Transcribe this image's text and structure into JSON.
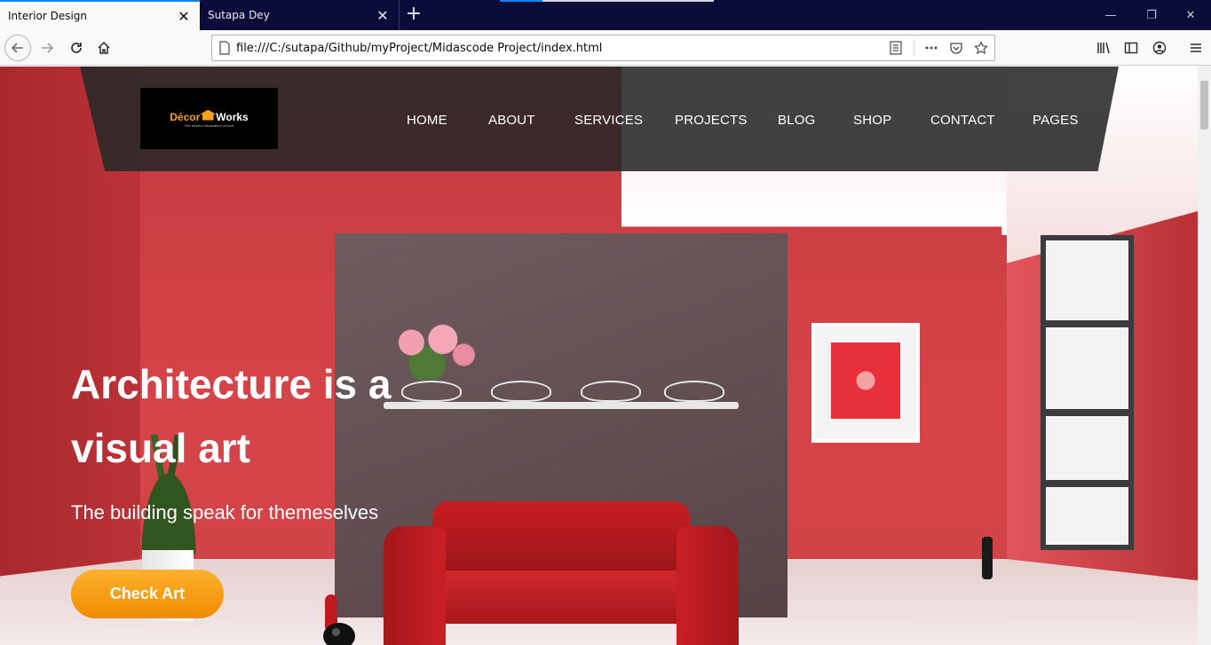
{
  "browser": {
    "tabs": [
      {
        "title": "Interior Design",
        "active": true
      },
      {
        "title": "Sutapa Dey",
        "active": false
      }
    ],
    "url": "file:///C:/sutapa/Github/myProject/Midascode Project/index.html"
  },
  "site": {
    "logo": {
      "part1": "Décor",
      "part2": "Works",
      "tagline": "The interior decoration choice"
    },
    "menu": [
      "HOME",
      "ABOUT",
      "SERVICES",
      "PROJECTS",
      "BLOG",
      "SHOP",
      "CONTACT",
      "PAGES"
    ],
    "hero": {
      "title_line1": "Architecture is a",
      "title_line2": "visual art",
      "subtitle": "The building speak for themeselves",
      "cta": "Check Art"
    }
  },
  "colors": {
    "accent": "#f5a21b",
    "cta": "#f8a01a",
    "header_overlay": "#2b2b2b",
    "wall": "#c93b40"
  }
}
